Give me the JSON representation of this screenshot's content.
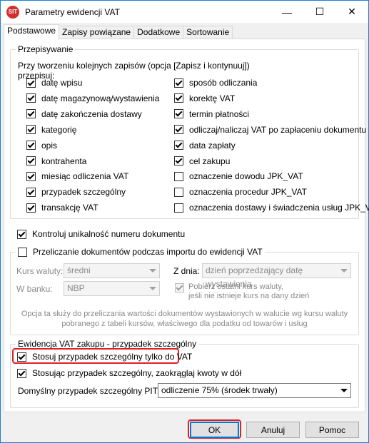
{
  "window": {
    "title": "Parametry ewidencji VAT",
    "icon_text": "SIT",
    "controls": {
      "minimize": "—",
      "maximize": "☐",
      "close": "✕"
    }
  },
  "tabs": [
    "Podstawowe",
    "Zapisy powiązane",
    "Dodatkowe",
    "Sortowanie"
  ],
  "przepisywanie": {
    "legend": "Przepisywanie",
    "intro_line1": "Przy tworzeniu kolejnych zapisów (opcja [Zapisz i kontynuuj])",
    "intro_line2": "przepisuj:",
    "left": [
      {
        "label": "datę wpisu",
        "checked": true
      },
      {
        "label": "datę magazynową/wystawienia",
        "checked": true
      },
      {
        "label": "datę zakończenia dostawy",
        "checked": true
      },
      {
        "label": "kategorię",
        "checked": true
      },
      {
        "label": "opis",
        "checked": true
      },
      {
        "label": "kontrahenta",
        "checked": true
      },
      {
        "label": "miesiąc odliczenia VAT",
        "checked": true
      },
      {
        "label": "przypadek szczególny",
        "checked": true
      },
      {
        "label": "transakcję VAT",
        "checked": true
      }
    ],
    "right": [
      {
        "label": "sposób odliczania",
        "checked": true
      },
      {
        "label": "korektę VAT",
        "checked": true
      },
      {
        "label": "termin płatności",
        "checked": true
      },
      {
        "label": "odliczaj/naliczaj VAT po zapłaceniu dokumentu",
        "checked": true
      },
      {
        "label": "data zapłaty",
        "checked": true
      },
      {
        "label": "cel zakupu",
        "checked": true
      },
      {
        "label": "oznaczenie dowodu JPK_VAT",
        "checked": false
      },
      {
        "label": "oznaczenia procedur JPK_VAT",
        "checked": false
      },
      {
        "label": "oznaczenia dostawy i świadczenia usług JPK_VAT",
        "checked": false
      }
    ]
  },
  "kontroluj": {
    "label": "Kontroluj unikalność numeru dokumentu",
    "checked": true
  },
  "przeliczanie": {
    "legend": "Przeliczanie dokumentów podczas importu do ewidencji VAT",
    "checked": false,
    "kurs_label": "Kurs waluty:",
    "kurs_value": "średni",
    "bank_label": "W banku:",
    "bank_value": "NBP",
    "zdnia_label": "Z dnia:",
    "zdnia_value": "dzień poprzedzający datę wystawienia",
    "pobierz_line1": "Pobierz ostatni kurs waluty,",
    "pobierz_line2": "jeśli nie istnieje kurs na dany dzień",
    "pobierz_checked": true,
    "note_line1": "Opcja ta służy do przeliczania wartości dokumentów wystawionych w walucie wg kursu waluty",
    "note_line2": "pobranego z tabeli kursów, właściwego dla podatku od towarów i usług"
  },
  "ewidencja": {
    "legend": "Ewidencja VAT zakupu - przypadek szczególny",
    "stosuj_label": "Stosuj przypadek szczególny tylko do VAT",
    "stosuj_checked": true,
    "zaokraglaj_label": "Stosując przypadek szczególny, zaokrąglaj kwoty w dół",
    "zaokraglaj_checked": true,
    "pit_label": "Domyślny przypadek szczególny PIT:",
    "pit_value": "odliczenie 75% (środek trwały)"
  },
  "buttons": {
    "ok": "OK",
    "cancel": "Anuluj",
    "help": "Pomoc"
  }
}
